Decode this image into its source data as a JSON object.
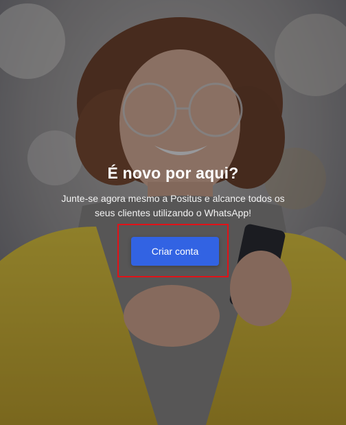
{
  "hero": {
    "title": "É novo por aqui?",
    "subtitle": "Junte-se agora mesmo a Positus e alcance todos os seus clientes utilizando o WhatsApp!",
    "cta_label": "Criar conta"
  },
  "colors": {
    "button": "#3263e3",
    "highlight_frame": "#e11218",
    "jacket": "#e9c82a"
  }
}
